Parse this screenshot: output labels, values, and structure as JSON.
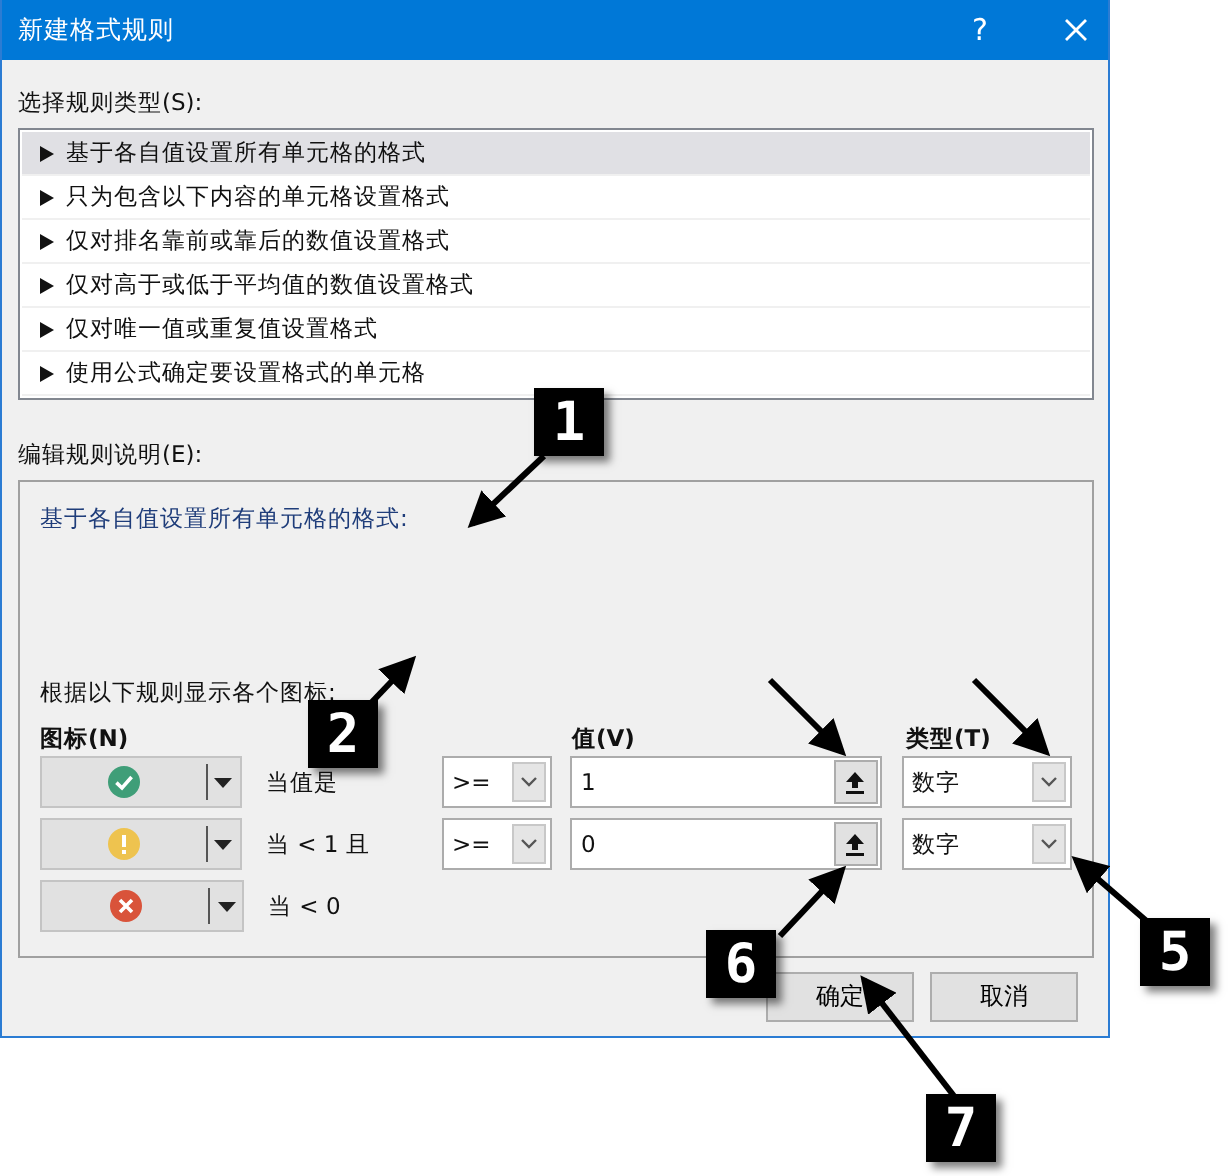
{
  "window": {
    "title": "新建格式规则",
    "help": "?"
  },
  "rule_type": {
    "label": "选择规则类型(S):",
    "items": [
      {
        "text": "基于各自值设置所有单元格的格式",
        "selected": true
      },
      {
        "text": "只为包含以下内容的单元格设置格式",
        "selected": false
      },
      {
        "text": "仅对排名靠前或靠后的数值设置格式",
        "selected": false
      },
      {
        "text": "仅对高于或低于平均值的数值设置格式",
        "selected": false
      },
      {
        "text": "仅对唯一值或重复值设置格式",
        "selected": false
      },
      {
        "text": "使用公式确定要设置格式的单元格",
        "selected": false
      }
    ]
  },
  "description": {
    "label": "编辑规则说明(E):",
    "heading": "基于各自值设置所有单元格的格式:",
    "rules_label": "根据以下规则显示各个图标:",
    "columns": {
      "icon": "图标(N)",
      "value": "值(V)",
      "type": "类型(T)"
    },
    "rows": [
      {
        "kind": "check",
        "condition": "当值是",
        "operator": ">=",
        "value": "1",
        "type": "数字"
      },
      {
        "kind": "exclamation",
        "condition": "当 < 1 且",
        "operator": ">=",
        "value": "0",
        "type": "数字"
      },
      {
        "kind": "cross",
        "condition": "当 < 0"
      }
    ]
  },
  "buttons": [
    {
      "label": "确定"
    },
    {
      "label": "取消"
    }
  ],
  "callouts": [
    {
      "number": "1"
    },
    {
      "number": "2"
    },
    {
      "number": "6"
    },
    {
      "number": "5"
    },
    {
      "number": "7"
    }
  ]
}
